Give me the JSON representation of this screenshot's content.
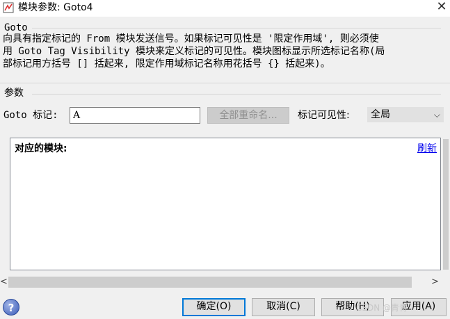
{
  "window": {
    "title": "模块参数: Goto4",
    "close_glyph": "✕",
    "app_icon": "simulink-block-icon"
  },
  "description_group": {
    "legend": "Goto",
    "lines": [
      "向具有指定标记的 From 模块发送信号。如果标记可见性是 '限定作用域', 则必须使",
      "用 Goto Tag Visibility 模块来定义标记的可见性。模块图标显示所选标记名称(局",
      "部标记用方括号 [] 括起来, 限定作用域标记名称用花括号 {} 括起来)。"
    ]
  },
  "params_group": {
    "legend": "参数",
    "goto_tag_label": "Goto 标记:",
    "goto_tag_value": "A",
    "rename_all_label": "全部重命名...",
    "visibility_label": "标记可见性:",
    "visibility_value": "全局",
    "visibility_chevron": "⌵"
  },
  "blocks_panel": {
    "title": "对应的模块:",
    "refresh_label": "刷新"
  },
  "scroll": {
    "left_arrow": "<",
    "right_arrow": ">"
  },
  "buttons": {
    "help_icon_glyph": "?",
    "ok_label": "确定(O)",
    "cancel_label": "取消(C)",
    "help_label": "帮助(H)",
    "apply_label": "应用(A)"
  },
  "watermark": "CSDN @青青"
}
